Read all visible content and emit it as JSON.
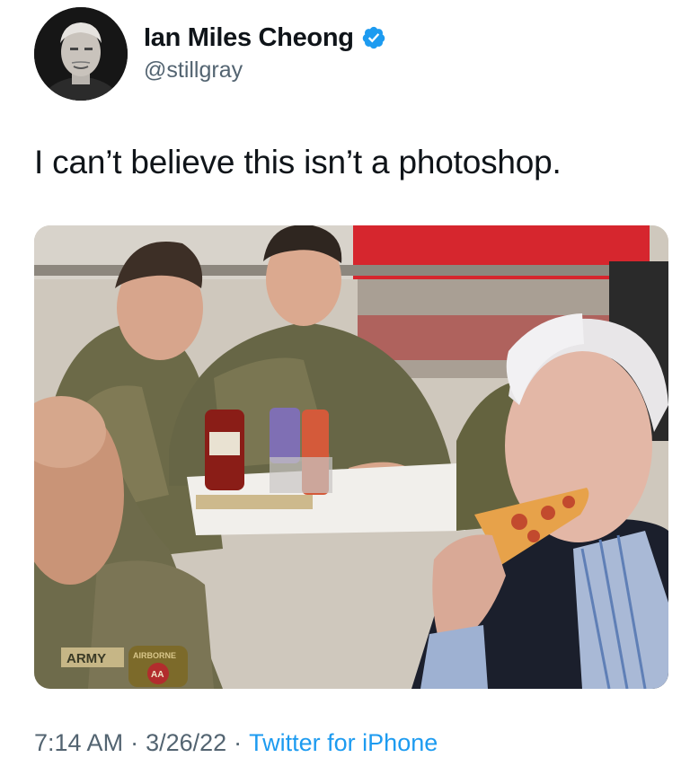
{
  "author": {
    "display_name": "Ian Miles Cheong",
    "handle": "@stillgray",
    "verified": true,
    "avatar_icon": "user-avatar",
    "verified_icon": "verified-badge-icon"
  },
  "tweet": {
    "text": "I can’t believe this isn’t a photoshop.",
    "media_patch_text": "ARMY",
    "media_patch_airborne": "AIRBORNE",
    "media_patch_aa": "AA"
  },
  "footer": {
    "time": "7:14 AM",
    "sep1": "·",
    "date": "3/26/22",
    "sep2": "·",
    "source": "Twitter for iPhone"
  },
  "colors": {
    "link": "#1d9bf0",
    "verified": "#1d9bf0",
    "text": "#0f1419",
    "muted": "#536471"
  }
}
